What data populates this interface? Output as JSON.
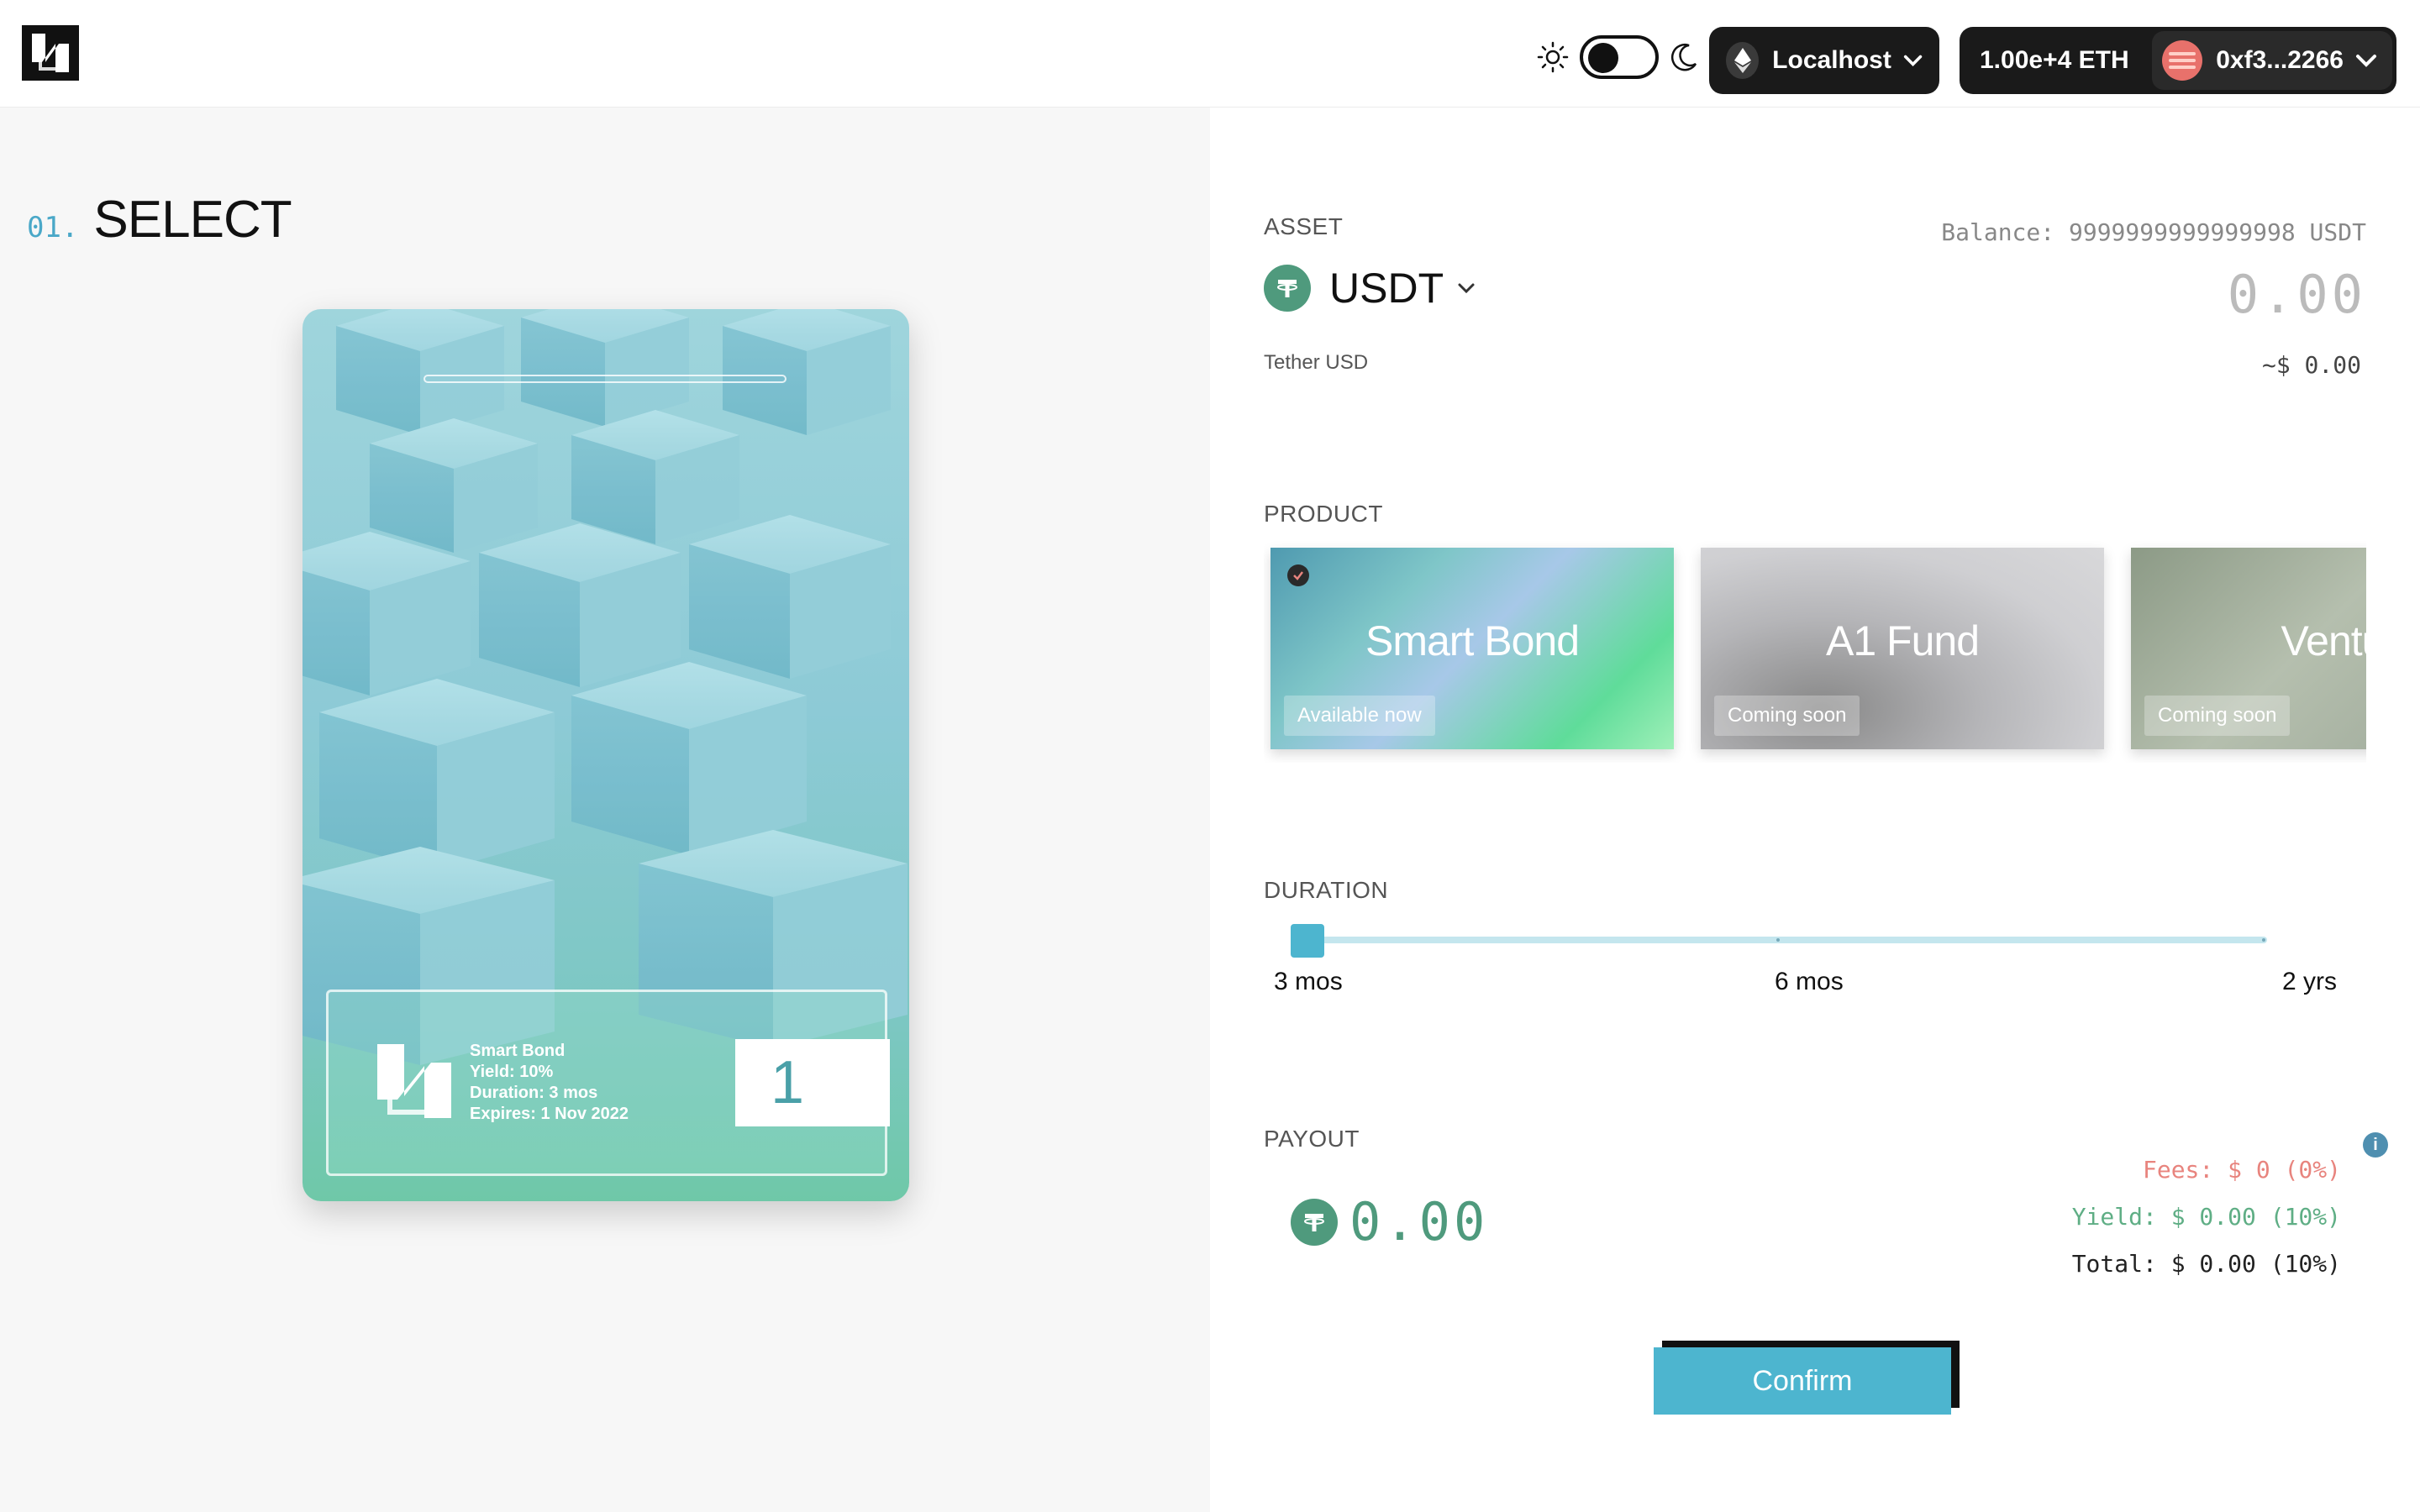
{
  "header": {
    "network": "Localhost",
    "eth_balance": "1.00e+4 ETH",
    "account": "0xf3...2266"
  },
  "step": {
    "number": "01.",
    "title": "SELECT"
  },
  "bond_card": {
    "product": "Smart Bond",
    "yield": "Yield: 10%",
    "duration": "Duration: 3 mos",
    "expires": "Expires: 1 Nov 2022",
    "token_id": "1"
  },
  "asset": {
    "label": "ASSET",
    "symbol": "USDT",
    "full_name": "Tether USD",
    "balance": "Balance: 9999999999999998 USDT",
    "amount": "0.00",
    "usd_value": "~$ 0.00"
  },
  "product": {
    "label": "PRODUCT",
    "items": [
      {
        "name": "Smart Bond",
        "status": "Available now",
        "selected": true
      },
      {
        "name": "A1 Fund",
        "status": "Coming soon",
        "selected": false
      },
      {
        "name": "Ventu",
        "status": "Coming soon",
        "selected": false
      }
    ]
  },
  "duration": {
    "label": "DURATION",
    "options": [
      "3 mos",
      "6 mos",
      "2 yrs"
    ],
    "selected": "3 mos"
  },
  "payout": {
    "label": "PAYOUT",
    "amount": "0.00",
    "fees": "Fees: $ 0 (0%)",
    "yield": "Yield: $ 0.00 (10%)",
    "total": "Total: $ 0.00 (10%)"
  },
  "confirm_label": "Confirm",
  "colors": {
    "accent": "#4db5cf",
    "tether_green": "#4f9a7d",
    "fee_red": "#e8847e",
    "yield_green": "#5fae85"
  }
}
